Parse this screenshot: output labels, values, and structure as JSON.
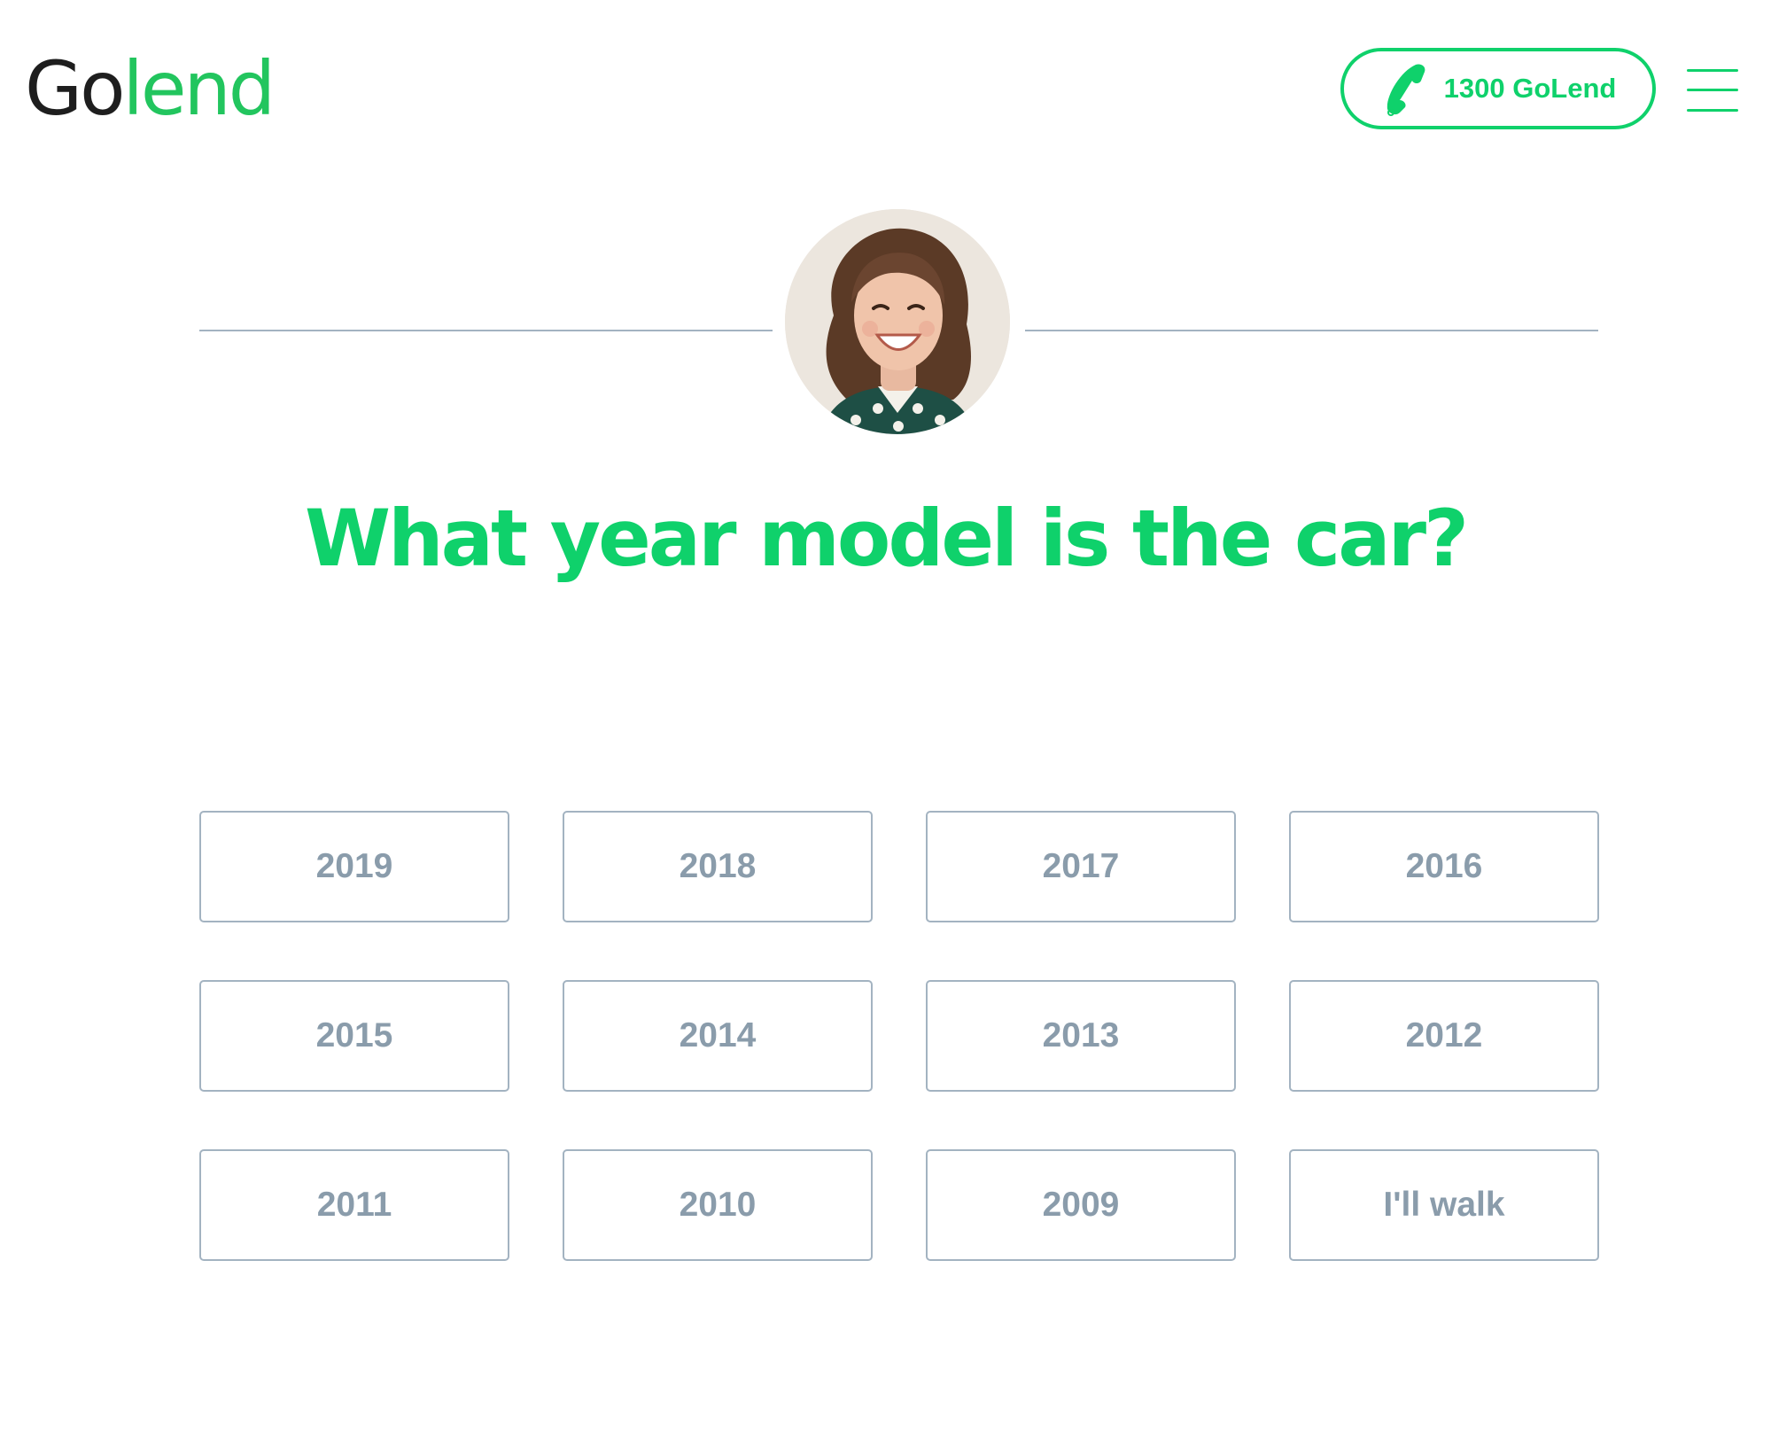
{
  "brand": {
    "logo_go": "Go",
    "logo_lend": "lend"
  },
  "header": {
    "phone_label": "1300 GoLend",
    "phone_icon": "phone-icon",
    "menu_icon": "hamburger-menu-icon"
  },
  "colors": {
    "accent": "#0fd16b",
    "logo_dark": "#1e1e1e",
    "option_border": "#a3b3c1",
    "option_text": "#8a9cab"
  },
  "question": {
    "title": "What year model is the car?"
  },
  "options": [
    {
      "label": "2019"
    },
    {
      "label": "2018"
    },
    {
      "label": "2017"
    },
    {
      "label": "2016"
    },
    {
      "label": "2015"
    },
    {
      "label": "2014"
    },
    {
      "label": "2013"
    },
    {
      "label": "2012"
    },
    {
      "label": "2011"
    },
    {
      "label": "2010"
    },
    {
      "label": "2009"
    },
    {
      "label": "I'll walk"
    }
  ]
}
